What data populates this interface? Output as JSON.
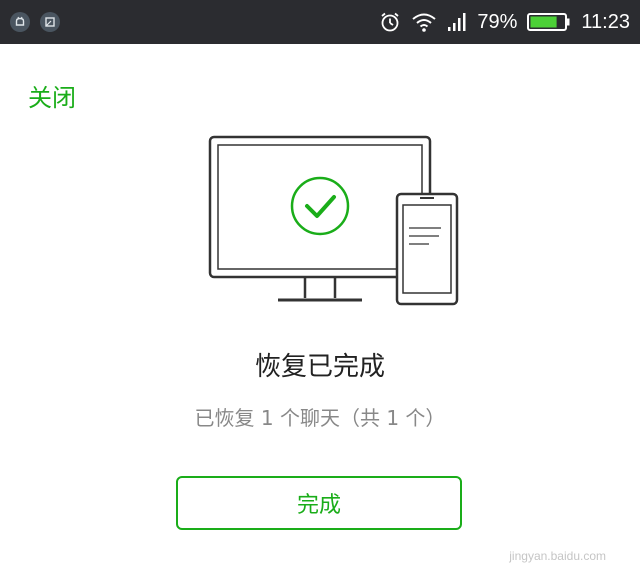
{
  "status_bar": {
    "battery_percent_text": "79%",
    "battery_level": 0.79,
    "time": "11:23",
    "left_icons": [
      "notification-app-icon",
      "screenshot-app-icon"
    ],
    "right_icons": [
      "alarm-icon",
      "wifi-icon",
      "signal-icon",
      "battery-icon"
    ]
  },
  "header": {
    "close_label": "关闭"
  },
  "illustration": {
    "icons": [
      "monitor-icon",
      "checkmark-icon",
      "phone-icon"
    ]
  },
  "main": {
    "title": "恢复已完成",
    "subtitle": "已恢复 1 个聊天（共 1 个）",
    "done_label": "完成"
  },
  "watermark": {
    "text": "jingyan.baidu.com"
  },
  "colors": {
    "accent": "#1aad19",
    "status_bar_bg": "#2b2c30",
    "title_text": "#222222",
    "subtitle_text": "#888888"
  }
}
